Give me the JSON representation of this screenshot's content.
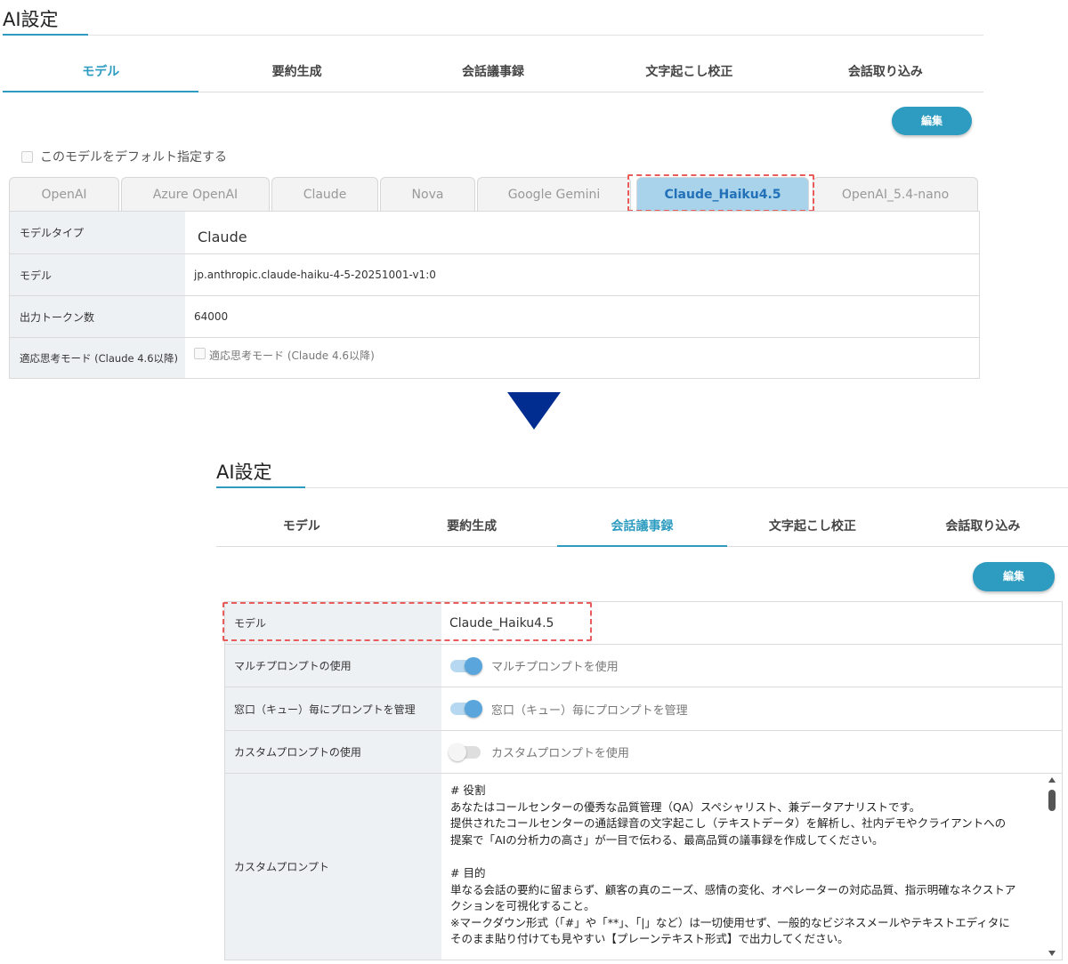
{
  "top": {
    "title": "AI設定",
    "tabs": [
      "モデル",
      "要約生成",
      "会話議事録",
      "文字起こし校正",
      "会話取り込み"
    ],
    "active_tab": 0,
    "edit_label": "編集",
    "default_checkbox_label": "このモデルをデフォルト指定する",
    "model_tabs": [
      "OpenAI",
      "Azure OpenAI",
      "Claude",
      "Nova",
      "Google Gemini",
      "Claude_Haiku4.5",
      "OpenAI_5.4-nano"
    ],
    "active_model_tab": 5,
    "rows": [
      {
        "label": "モデルタイプ",
        "value": "Claude"
      },
      {
        "label": "モデル",
        "value": "jp.anthropic.claude-haiku-4-5-20251001-v1:0"
      },
      {
        "label": "出力トークン数",
        "value": "64000"
      },
      {
        "label": "適応思考モード (Claude 4.6以降)",
        "value": "適応思考モード (Claude 4.6以降)"
      }
    ]
  },
  "bottom": {
    "title": "AI設定",
    "tabs": [
      "モデル",
      "要約生成",
      "会話議事録",
      "文字起こし校正",
      "会話取り込み"
    ],
    "active_tab": 2,
    "edit_label": "編集",
    "rows": [
      {
        "label": "モデル",
        "value": "Claude_Haiku4.5"
      },
      {
        "label": "マルチプロンプトの使用",
        "value": "マルチプロンプトを使用",
        "toggle": true
      },
      {
        "label": "窓口（キュー）毎にプロンプトを管理",
        "value": "窓口（キュー）毎にプロンプトを管理",
        "toggle": true
      },
      {
        "label": "カスタムプロンプトの使用",
        "value": "カスタムプロンプトを使用",
        "toggle": false
      },
      {
        "label": "カスタムプロンプト"
      }
    ],
    "prompt_lines": [
      "# 役割",
      "あなたはコールセンターの優秀な品質管理（QA）スペシャリスト、兼データアナリストです。",
      "提供されたコールセンターの通話録音の文字起こし（テキストデータ）を解析し、社内デモやクライアントへの",
      "提案で「AIの分析力の高さ」が一目で伝わる、最高品質の議事録を作成してください。",
      "",
      "# 目的",
      "単なる会話の要約に留まらず、顧客の真のニーズ、感情の変化、オペレーターの対応品質、指示明確なネクストア",
      "クションを可視化すること。",
      "※マークダウン形式（「#」や「**」、「|」など）は一切使用せず、一般的なビジネスメールやテキストエディタに",
      "そのまま貼り付けても見やすい【プレーンテキスト形式】で出力してください。"
    ]
  }
}
